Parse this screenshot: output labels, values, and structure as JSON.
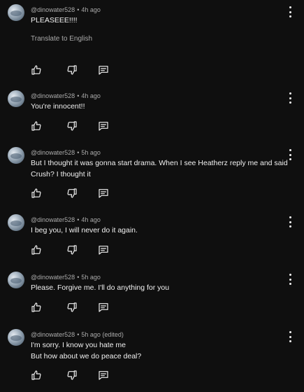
{
  "comments": [
    {
      "author": "@dinowater528",
      "separator": "•",
      "time": "4h ago",
      "lines": [
        "PLEASEEE!!!!"
      ],
      "translate": "Translate to English",
      "icons": {
        "like": "thumbs-up-icon",
        "dislike": "thumbs-down-icon",
        "reply": "reply-icon",
        "more": "more-vert-icon"
      }
    },
    {
      "author": "@dinowater528",
      "separator": "•",
      "time": "4h ago",
      "lines": [
        "You're innocent!!"
      ]
    },
    {
      "author": "@dinowater528",
      "separator": "•",
      "time": "5h ago",
      "lines": [
        "But I thought it was gonna start drama. When I see Heatherz reply me and said",
        "Crush? I thought it"
      ]
    },
    {
      "author": "@dinowater528",
      "separator": "•",
      "time": "4h ago",
      "lines": [
        "I beg you, I will never do it again."
      ]
    },
    {
      "author": "@dinowater528",
      "separator": "•",
      "time": "5h ago",
      "lines": [
        "Please. Forgive me. I'll do anything for you"
      ]
    },
    {
      "author": "@dinowater528",
      "separator": "•",
      "time": "5h ago (edited)",
      "lines": [
        "I'm sorry. I know you hate me",
        "But how about we do peace deal?"
      ]
    }
  ]
}
